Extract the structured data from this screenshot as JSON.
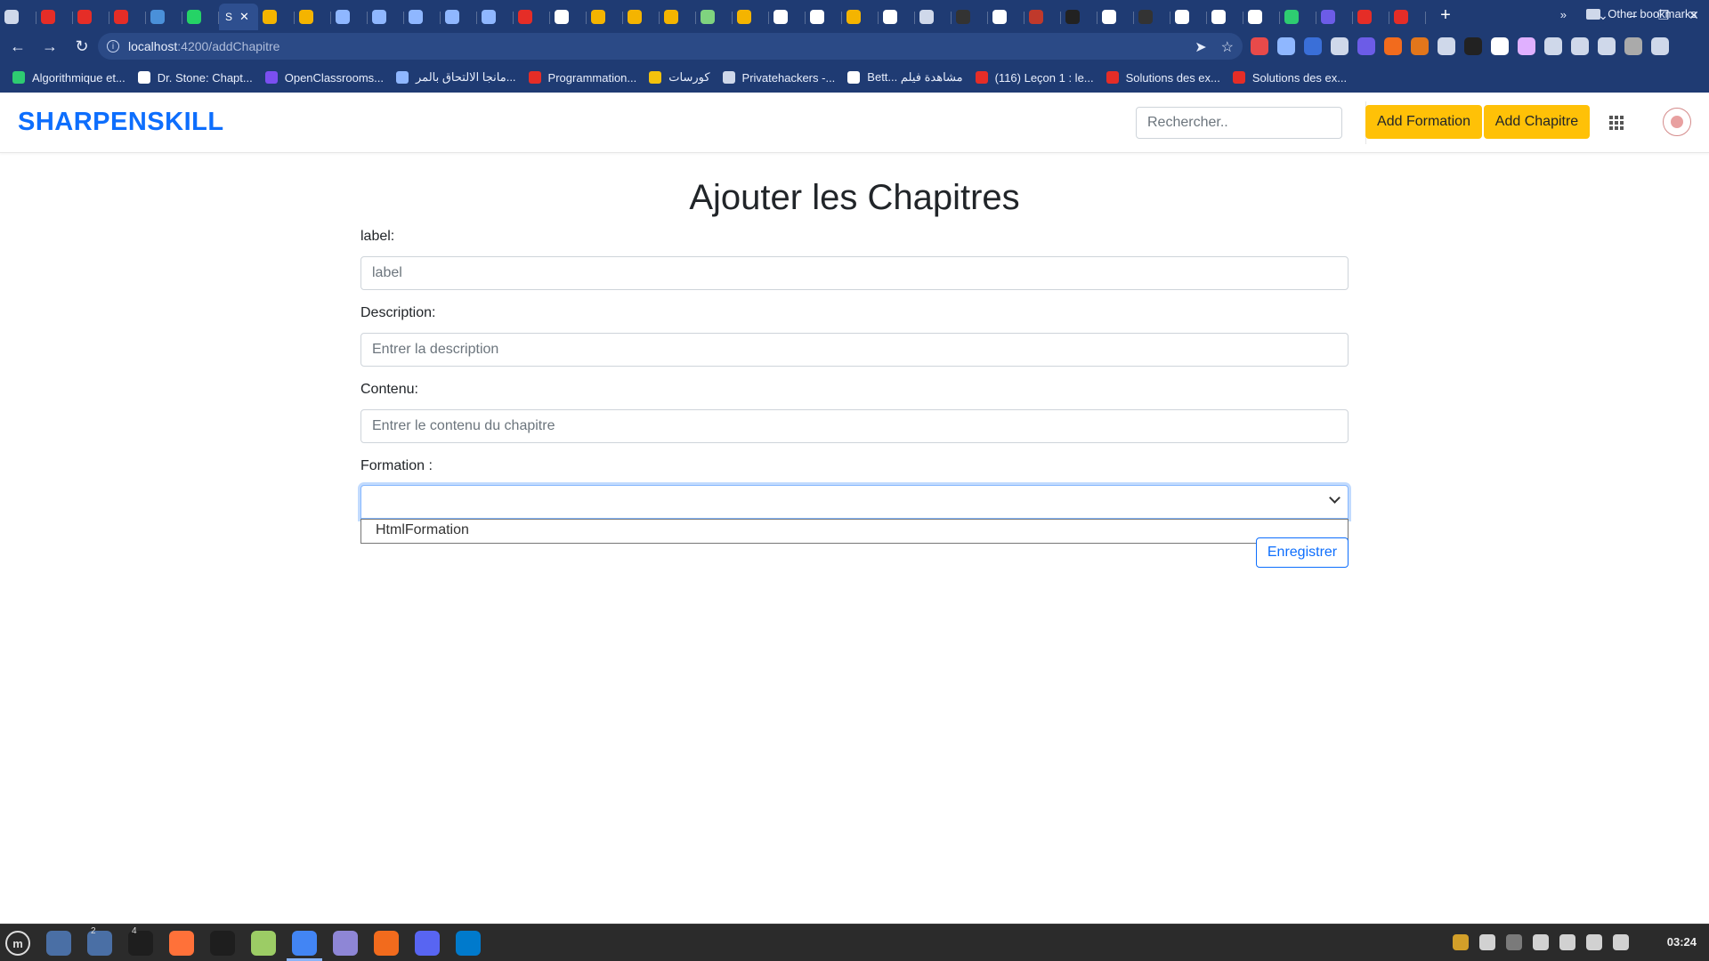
{
  "browser": {
    "tabs": [
      {
        "color": "#cfd8ea"
      },
      {
        "color": "#e52d27"
      },
      {
        "color": "#e52d27"
      },
      {
        "color": "#e52d27"
      },
      {
        "color": "#4a90d9"
      },
      {
        "color": "#25d366"
      },
      {
        "color": "#f4b400"
      },
      {
        "color": "#f4b400"
      },
      {
        "color": "#f4b400"
      },
      {
        "color": "#8fb7ff"
      },
      {
        "color": "#8fb7ff"
      },
      {
        "color": "#8fb7ff"
      },
      {
        "color": "#8fb7ff"
      },
      {
        "color": "#8fb7ff"
      },
      {
        "color": "#e52d27"
      },
      {
        "color": "#ffffff"
      },
      {
        "color": "#f4b400"
      },
      {
        "color": "#f4b400"
      },
      {
        "color": "#f4b400"
      },
      {
        "color": "#7fd37f"
      },
      {
        "color": "#f4b400"
      },
      {
        "color": "#ffffff"
      },
      {
        "color": "#ffffff"
      },
      {
        "color": "#f4b400"
      },
      {
        "color": "#ffffff"
      },
      {
        "color": "#cfd8ea"
      },
      {
        "color": "#333333"
      },
      {
        "color": "#ffffff"
      },
      {
        "color": "#c0392b"
      },
      {
        "color": "#222222"
      },
      {
        "color": "#ffffff"
      },
      {
        "color": "#333333"
      },
      {
        "color": "#ffffff"
      },
      {
        "color": "#ffffff"
      },
      {
        "color": "#ffffff"
      },
      {
        "color": "#2ecc71"
      },
      {
        "color": "#6c5ce7"
      },
      {
        "color": "#e52d27"
      },
      {
        "color": "#e52d27"
      }
    ],
    "active_tab": {
      "letter": "S",
      "close": "✕"
    },
    "new_tab": "+",
    "window_controls": [
      "⌄",
      "–",
      "❐",
      "✕"
    ],
    "url_host": "localhost",
    "url_path": ":4200/addChapitre",
    "bookmarks": [
      {
        "label": "Algorithmique et...",
        "color": "#2ecc71"
      },
      {
        "label": "Dr. Stone: Chapt...",
        "color": "#ffffff"
      },
      {
        "label": "OpenClassrooms...",
        "color": "#7b4ff0"
      },
      {
        "label": "مانجا الالتحاق بالمر...",
        "color": "#8fb7ff"
      },
      {
        "label": "Programmation...",
        "color": "#e52d27"
      },
      {
        "label": "كورسات",
        "color": "#f4c20d"
      },
      {
        "label": "Privatehackers -...",
        "color": "#cfd8ea"
      },
      {
        "label": "Bett... مشاهدة فيلم",
        "color": "#ffffff"
      },
      {
        "label": "(116) Leçon 1 : le...",
        "color": "#e52d27"
      },
      {
        "label": "Solutions des ex...",
        "color": "#e52d27"
      },
      {
        "label": "Solutions des ex...",
        "color": "#e52d27"
      }
    ],
    "bookmarks_more": "»",
    "other_bookmarks": "Other bookmarks"
  },
  "navbar": {
    "brand": "SHARPENSKILL",
    "search_placeholder": "Rechercher..",
    "add_formation": "Add Formation",
    "add_chapitre": "Add Chapitre"
  },
  "form": {
    "title": "Ajouter les Chapitres",
    "label_label": "label:",
    "label_placeholder": "label",
    "description_label": "Description:",
    "description_placeholder": "Entrer la description",
    "contenu_label": "Contenu:",
    "contenu_placeholder": "Entrer le contenu du chapitre",
    "formation_label": "Formation :",
    "formation_options": [
      "HtmlFormation"
    ],
    "submit": "Enregistrer"
  },
  "taskbar": {
    "apps": [
      {
        "color": "#4a6fa5"
      },
      {
        "color": "#4a6fa5",
        "badge": "2"
      },
      {
        "color": "#1e1e1e",
        "badge": "4"
      },
      {
        "color": "#ff7139"
      },
      {
        "color": "#1e1e1e"
      },
      {
        "color": "#9ccc65"
      },
      {
        "color": "#4285f4"
      },
      {
        "color": "#8e86d6"
      },
      {
        "color": "#f26b1d"
      },
      {
        "color": "#5865f2"
      },
      {
        "color": "#007acc"
      }
    ],
    "tray": [
      {
        "color": "#f0b429"
      },
      {
        "color": "#eeeeee"
      },
      {
        "color": "#888888"
      },
      {
        "color": "#eeeeee"
      },
      {
        "color": "#eeeeee"
      },
      {
        "color": "#eeeeee"
      },
      {
        "color": "#eeeeee"
      }
    ],
    "clock": "03:24"
  }
}
